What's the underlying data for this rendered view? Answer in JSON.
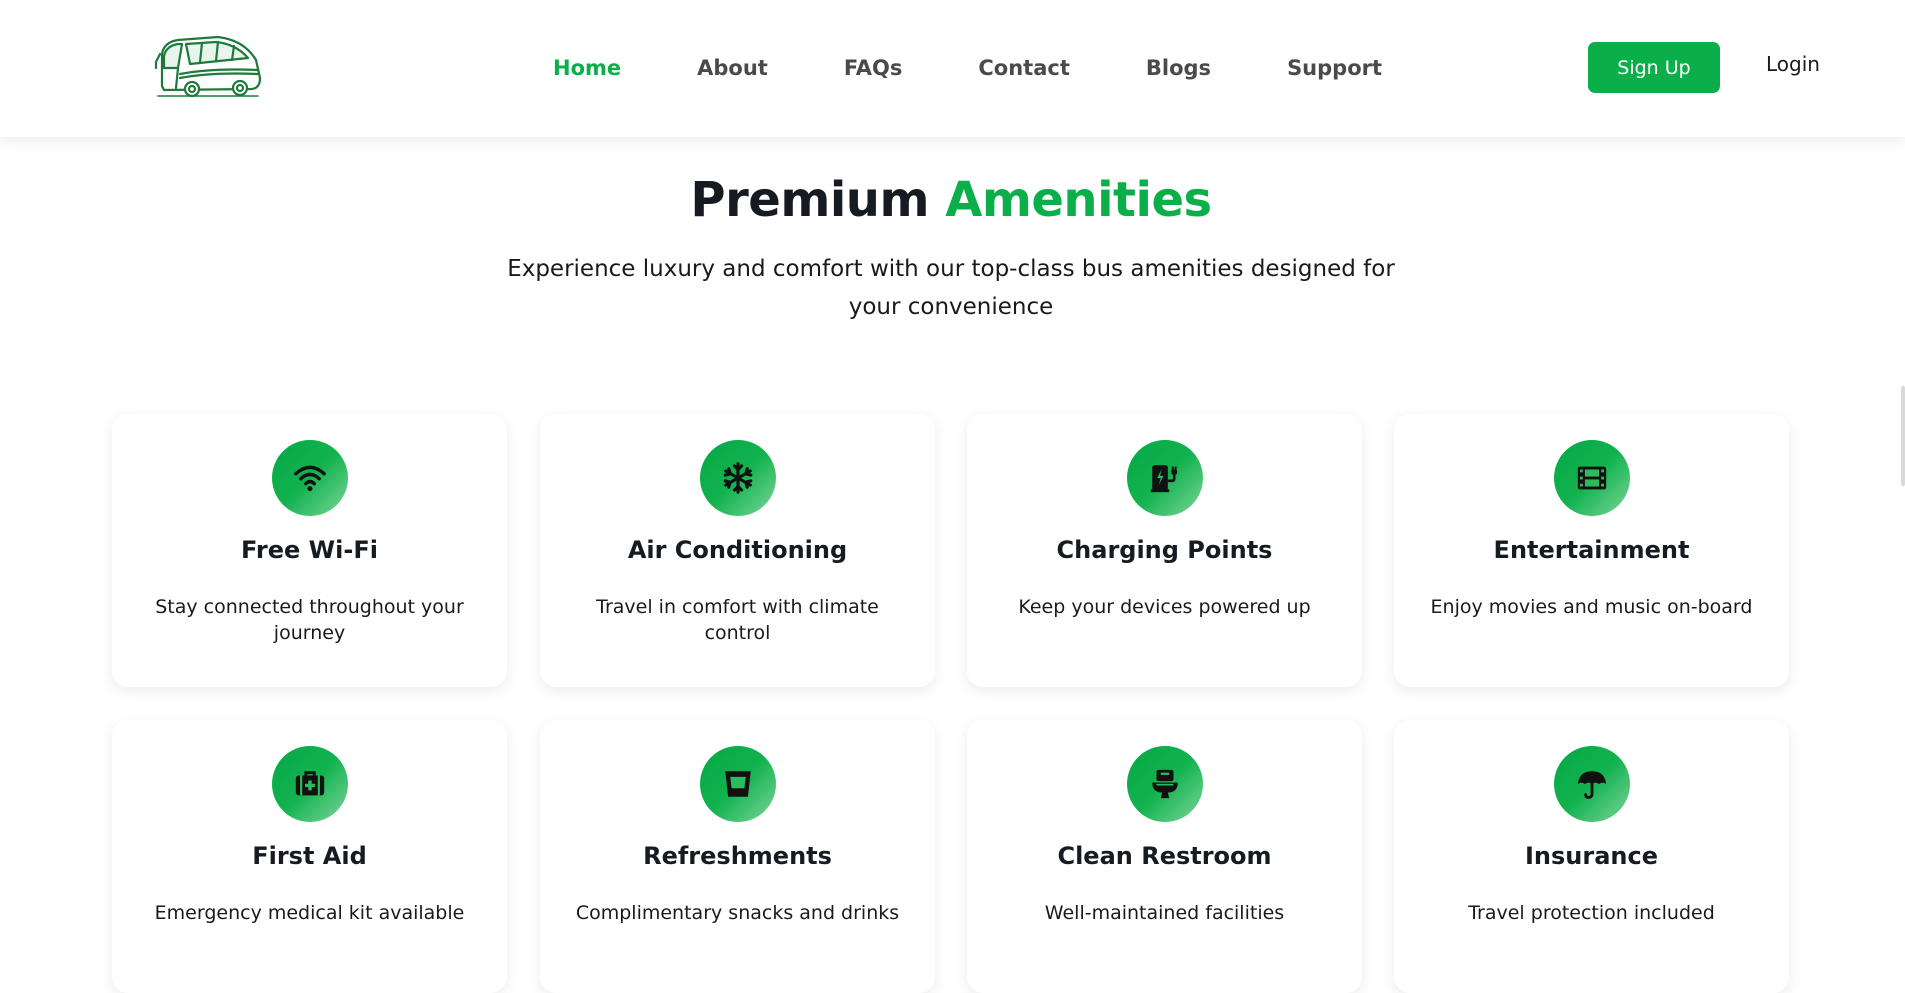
{
  "header": {
    "logo_icon": "bus-logo-icon",
    "nav": [
      {
        "label": "Home",
        "active": true
      },
      {
        "label": "About",
        "active": false
      },
      {
        "label": "FAQs",
        "active": false
      },
      {
        "label": "Contact",
        "active": false
      },
      {
        "label": "Blogs",
        "active": false
      },
      {
        "label": "Support",
        "active": false
      }
    ],
    "signup_label": "Sign Up",
    "login_label": "Login"
  },
  "section": {
    "title_main": "Premium",
    "title_accent": "Amenities",
    "subtitle": "Experience luxury and comfort with our top-class bus amenities designed for your convenience"
  },
  "amenities": [
    {
      "icon": "wifi-icon",
      "title": "Free Wi-Fi",
      "desc": "Stay connected throughout your journey"
    },
    {
      "icon": "snowflake-icon",
      "title": "Air Conditioning",
      "desc": "Travel in comfort with climate control"
    },
    {
      "icon": "charging-station-icon",
      "title": "Charging Points",
      "desc": "Keep your devices powered up"
    },
    {
      "icon": "film-icon",
      "title": "Entertainment",
      "desc": "Enjoy movies and music on-board"
    },
    {
      "icon": "medkit-icon",
      "title": "First Aid",
      "desc": "Emergency medical kit available"
    },
    {
      "icon": "glass-icon",
      "title": "Refreshments",
      "desc": "Complimentary snacks and drinks"
    },
    {
      "icon": "toilet-icon",
      "title": "Clean Restroom",
      "desc": "Well-maintained facilities"
    },
    {
      "icon": "umbrella-icon",
      "title": "Insurance",
      "desc": "Travel protection included"
    }
  ],
  "colors": {
    "accent": "#0aaf4a",
    "heading": "#161b22",
    "nav_text": "#4a4a4a"
  }
}
